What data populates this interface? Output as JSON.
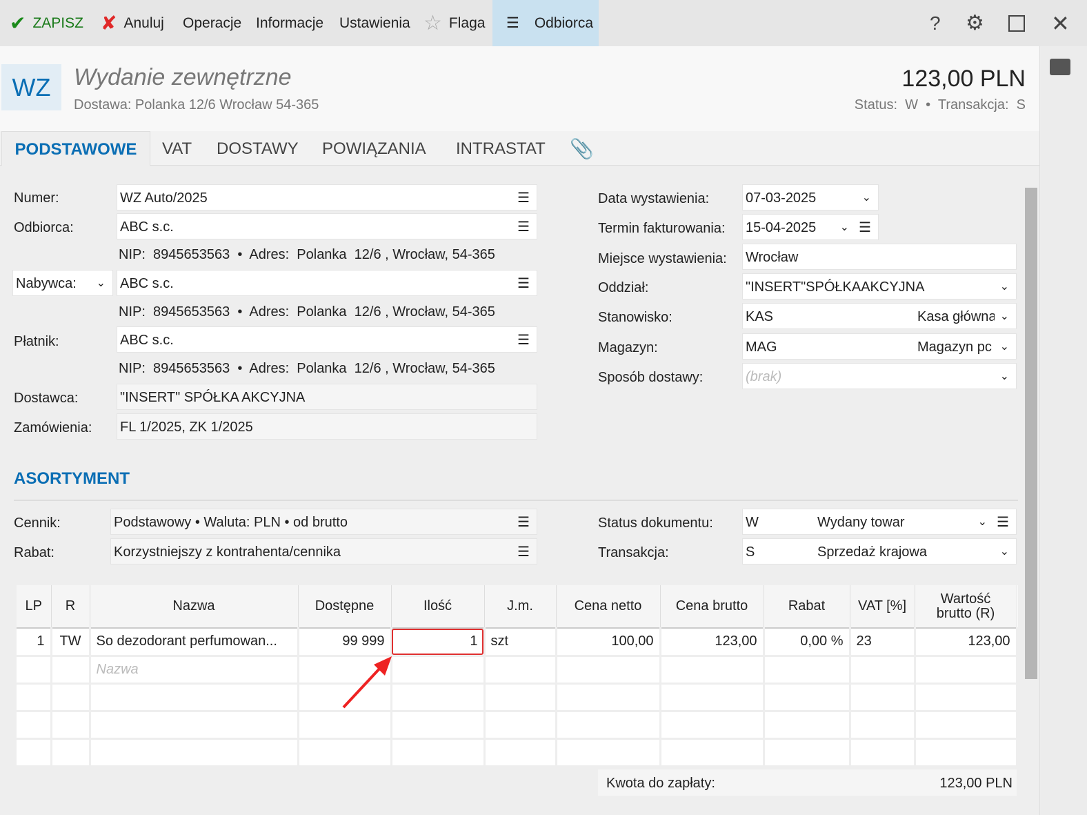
{
  "toolbar": {
    "save": "ZAPISZ",
    "cancel": "Anuluj",
    "operations": "Operacje",
    "info": "Informacje",
    "settings": "Ustawienia",
    "flag": "Flaga",
    "recipient": "Odbiorca",
    "help": "?"
  },
  "header": {
    "badge": "WZ",
    "title": "Wydanie zewnętrzne",
    "subtitle": "Dostawa: Polanka  12/6  Wrocław 54-365",
    "amount": "123,00 PLN",
    "status": "Status:  W  •  Transakcja:  S"
  },
  "tabs": [
    "PODSTAWOWE",
    "VAT",
    "DOSTAWY",
    "POWIĄZANIA",
    "INTRASTAT"
  ],
  "form": {
    "numer_label": "Numer:",
    "numer": "WZ Auto/2025",
    "odbiorca_label": "Odbiorca:",
    "odbiorca": "ABC s.c.",
    "info_line": "NIP:  8945653563  •  Adres:  Polanka  12/6 , Wrocław, 54-365",
    "nabywca_label": "Nabywca:",
    "nabywca": "ABC s.c.",
    "platnik_label": "Płatnik:",
    "platnik": "ABC s.c.",
    "dostawca_label": "Dostawca:",
    "dostawca": "\"INSERT\" SPÓŁKA AKCYJNA",
    "zamowienia_label": "Zamówienia:",
    "zamowienia": "FL 1/2025, ZK 1/2025",
    "data_label": "Data wystawienia:",
    "data": "07-03-2025",
    "termin_label": "Termin fakturowania:",
    "termin": "15-04-2025",
    "miejsce_label": "Miejsce wystawienia:",
    "miejsce": "Wrocław",
    "oddzial_label": "Oddział:",
    "oddzial": "\"INSERT\"SPÓŁKAAKCYJNA",
    "stanowisko_label": "Stanowisko:",
    "stanowisko_code": "KAS",
    "stanowisko_name": "Kasa główna",
    "magazyn_label": "Magazyn:",
    "magazyn_code": "MAG",
    "magazyn_name": "Magazyn pc",
    "sposob_label": "Sposób dostawy:",
    "sposob": "(brak)"
  },
  "asortyment": {
    "title": "ASORTYMENT",
    "cennik_label": "Cennik:",
    "cennik": "Podstawowy • Waluta: PLN • od brutto",
    "rabat_label": "Rabat:",
    "rabat": "Korzystniejszy z kontrahenta/cennika",
    "status_label": "Status dokumentu:",
    "status_code": "W",
    "status_name": "Wydany towar",
    "trans_label": "Transakcja:",
    "trans_code": "S",
    "trans_name": "Sprzedaż krajowa"
  },
  "table": {
    "headers": [
      "LP",
      "R",
      "Nazwa",
      "Dostępne",
      "Ilość",
      "J.m.",
      "Cena netto",
      "Cena brutto",
      "Rabat",
      "VAT [%]",
      "Wartość brutto (R)"
    ],
    "rows": [
      [
        "1",
        "TW",
        "So dezodorant perfumowan...",
        "99 999",
        "1",
        "szt",
        "100,00",
        "123,00",
        "0,00 %",
        "23",
        "123,00"
      ]
    ],
    "new_placeholder": "Nazwa"
  },
  "total": {
    "label": "Kwota do zapłaty:",
    "value": "123,00 PLN"
  }
}
